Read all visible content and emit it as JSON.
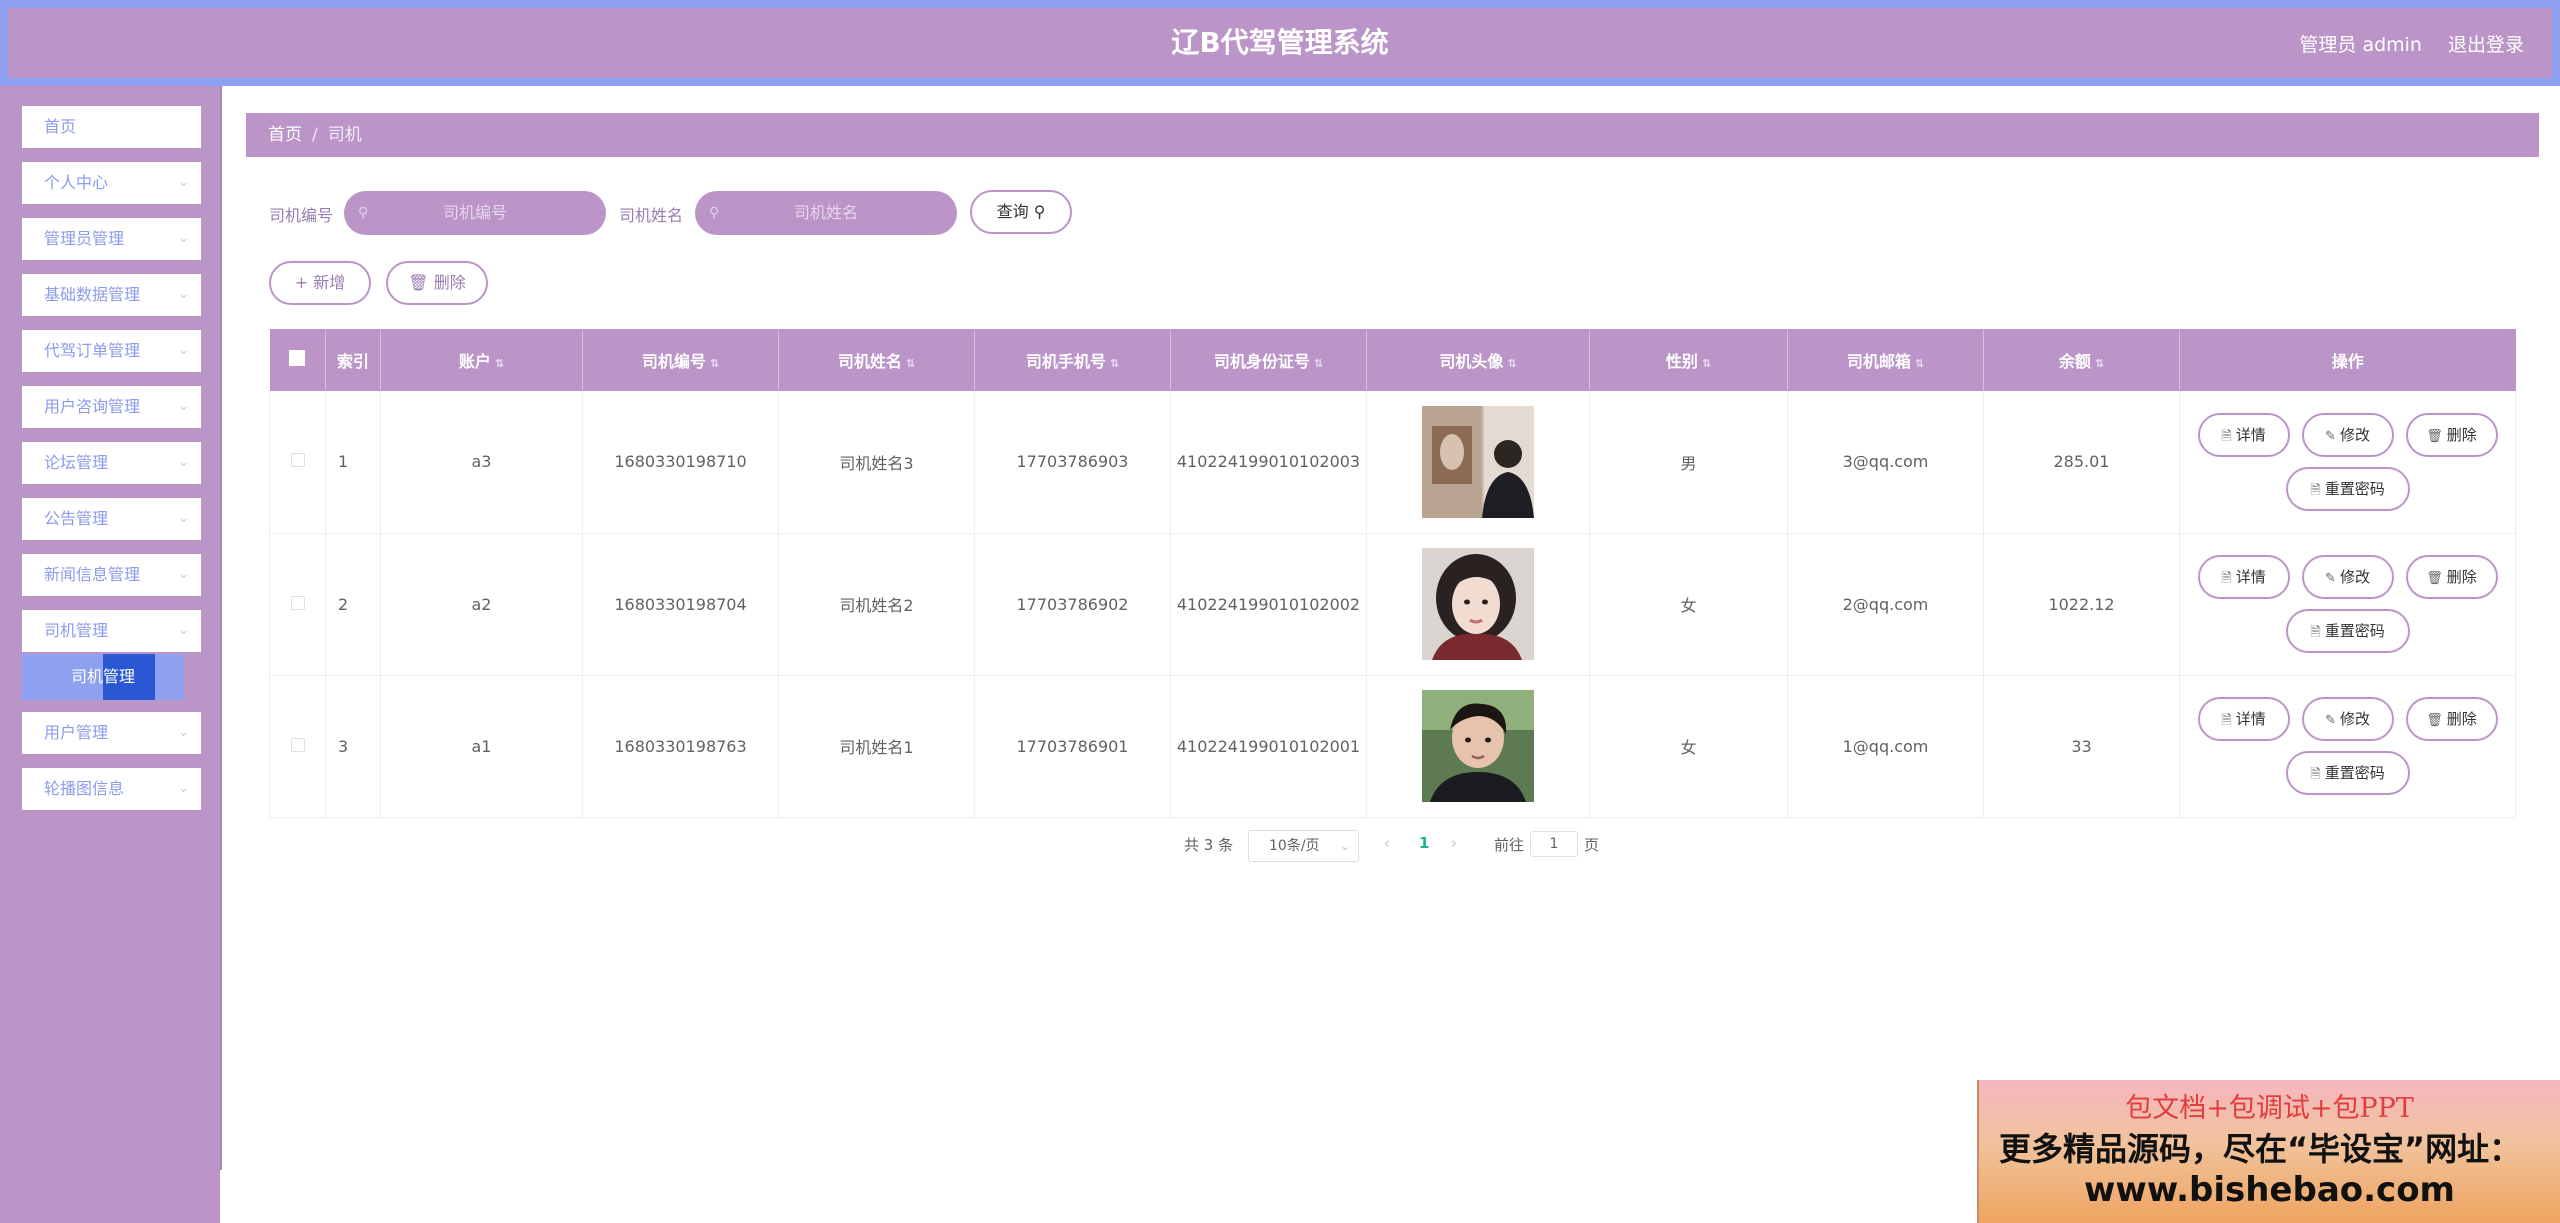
{
  "header": {
    "title": "辽B代驾管理系统",
    "user": "管理员 admin",
    "logout": "退出登录"
  },
  "sidebar": {
    "items": [
      {
        "label": "首页",
        "expandable": false
      },
      {
        "label": "个人中心",
        "expandable": true
      },
      {
        "label": "管理员管理",
        "expandable": true
      },
      {
        "label": "基础数据管理",
        "expandable": true
      },
      {
        "label": "代驾订单管理",
        "expandable": true
      },
      {
        "label": "用户咨询管理",
        "expandable": true
      },
      {
        "label": "论坛管理",
        "expandable": true
      },
      {
        "label": "公告管理",
        "expandable": true
      },
      {
        "label": "新闻信息管理",
        "expandable": true
      },
      {
        "label": "司机管理",
        "expandable": true
      },
      {
        "label": "用户管理",
        "expandable": true
      },
      {
        "label": "轮播图信息",
        "expandable": true
      }
    ],
    "active_sub": "司机管理"
  },
  "breadcrumb": {
    "home": "首页",
    "separator": "/",
    "current": "司机"
  },
  "search": {
    "driver_no_label": "司机编号",
    "driver_no_placeholder": "司机编号",
    "driver_name_label": "司机姓名",
    "driver_name_placeholder": "司机姓名",
    "query_label": "查询"
  },
  "toolbar": {
    "add_label": "新增",
    "delete_label": "删除"
  },
  "table": {
    "columns": [
      "索引",
      "账户",
      "司机编号",
      "司机姓名",
      "司机手机号",
      "司机身份证号",
      "司机头像",
      "性别",
      "司机邮箱",
      "余额",
      "操作"
    ],
    "rows": [
      {
        "index": "1",
        "account": "a3",
        "driver_no": "1680330198710",
        "name": "司机姓名3",
        "phone": "17703786903",
        "id_card": "410224199010102003",
        "avatar": "avatar-photo-man-back",
        "gender": "男",
        "email": "3@qq.com",
        "balance": "285.01"
      },
      {
        "index": "2",
        "account": "a2",
        "driver_no": "1680330198704",
        "name": "司机姓名2",
        "phone": "17703786902",
        "id_card": "410224199010102002",
        "avatar": "avatar-photo-girl",
        "gender": "女",
        "email": "2@qq.com",
        "balance": "1022.12"
      },
      {
        "index": "3",
        "account": "a1",
        "driver_no": "1680330198763",
        "name": "司机姓名1",
        "phone": "17703786901",
        "id_card": "410224199010102001",
        "avatar": "avatar-photo-young-man",
        "gender": "女",
        "email": "1@qq.com",
        "balance": "33"
      }
    ],
    "actions": {
      "detail": "详情",
      "edit": "修改",
      "delete": "删除",
      "reset_pwd": "重置密码"
    }
  },
  "pagination": {
    "total": "共 3 条",
    "page_size": "10条/页",
    "current_page": "1",
    "goto_label": "前往",
    "goto_value": "1",
    "page_unit": "页"
  },
  "promo": {
    "line1": "包文档+包调试+包PPT",
    "line2": "更多精品源码，尽在“毕设宝”网址：",
    "line3": "www.bishebao.com"
  },
  "colors": {
    "accent": "#bb94c8",
    "header_border": "#8ea0f0",
    "menu_text": "#8b9bee",
    "active_sub": "#8ea0f0",
    "active_page": "#1ab394"
  }
}
